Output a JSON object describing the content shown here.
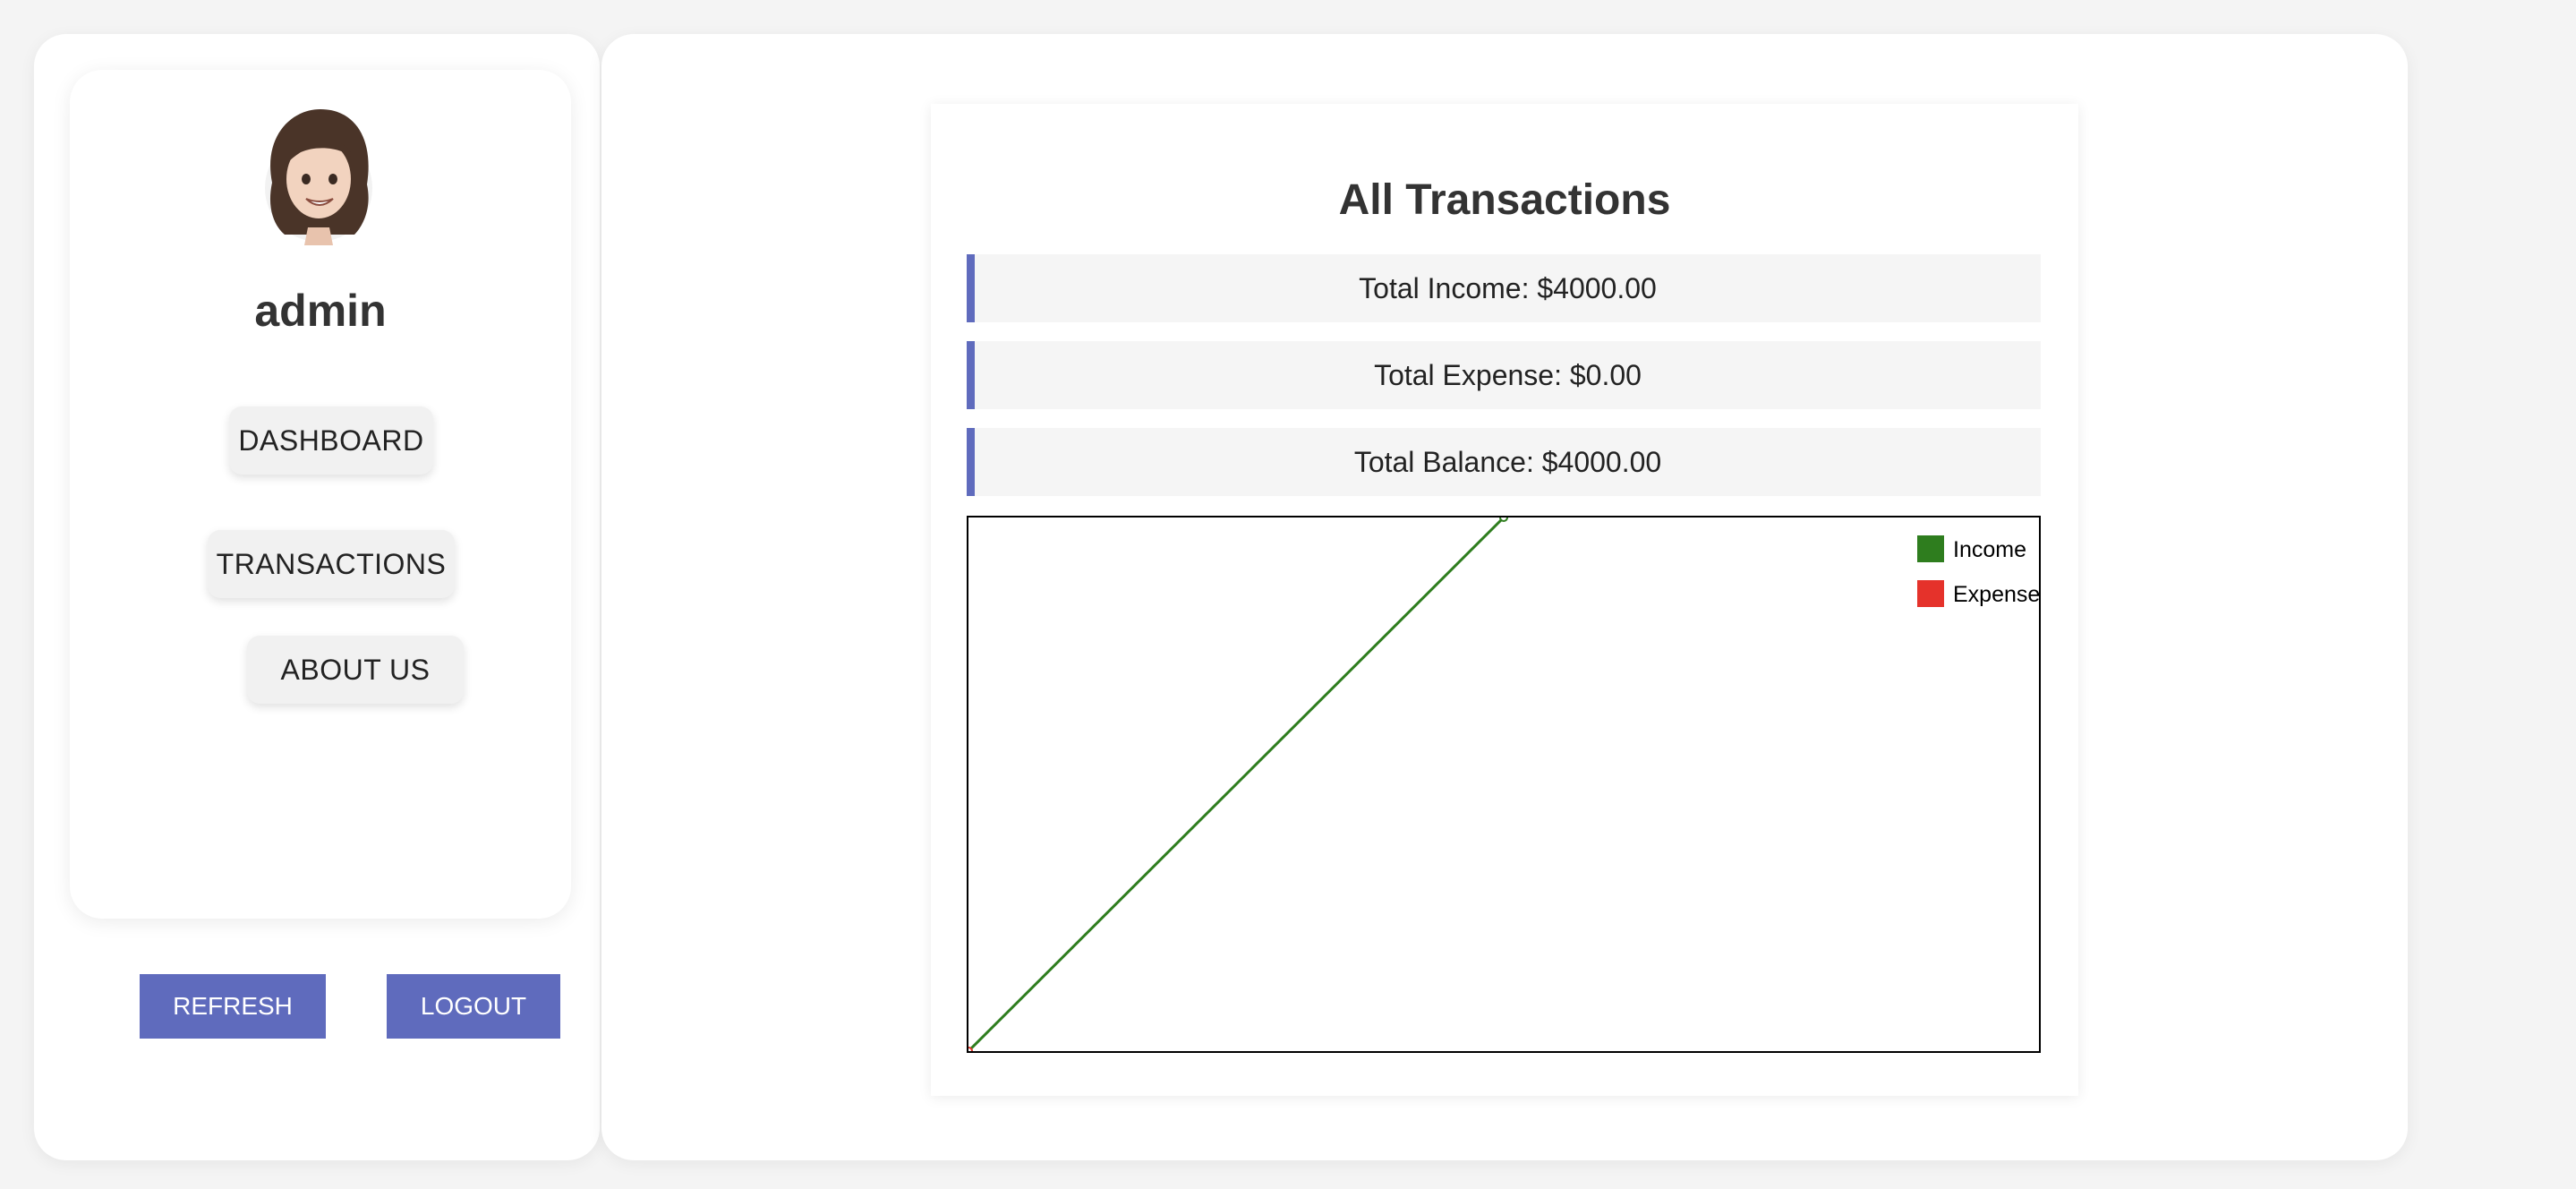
{
  "sidebar": {
    "username": "admin",
    "avatar_icon": "avatar-memoji-icon",
    "nav": [
      {
        "label": "DASHBOARD"
      },
      {
        "label": "TRANSACTIONS"
      },
      {
        "label": "ABOUT US"
      }
    ],
    "refresh_label": "REFRESH",
    "logout_label": "LOGOUT"
  },
  "main": {
    "title": "All Transactions",
    "total_income": "Total Income: $4000.00",
    "total_expense": "Total Expense: $0.00",
    "total_balance": "Total Balance: $4000.00"
  },
  "colors": {
    "accent": "#5f6bbd",
    "income": "#2e7d1e",
    "expense": "#e5322b"
  },
  "chart_data": {
    "type": "line",
    "title": "",
    "xlabel": "",
    "ylabel": "",
    "grid": false,
    "legend_position": "top-right",
    "series": [
      {
        "name": "Income",
        "color": "#2e7d1e",
        "x": [
          0,
          1
        ],
        "values": [
          0,
          4000
        ]
      },
      {
        "name": "Expense",
        "color": "#e5322b",
        "x": [
          0
        ],
        "values": [
          0
        ]
      }
    ],
    "xlim": [
      0,
      2
    ],
    "ylim": [
      0,
      4000
    ]
  }
}
